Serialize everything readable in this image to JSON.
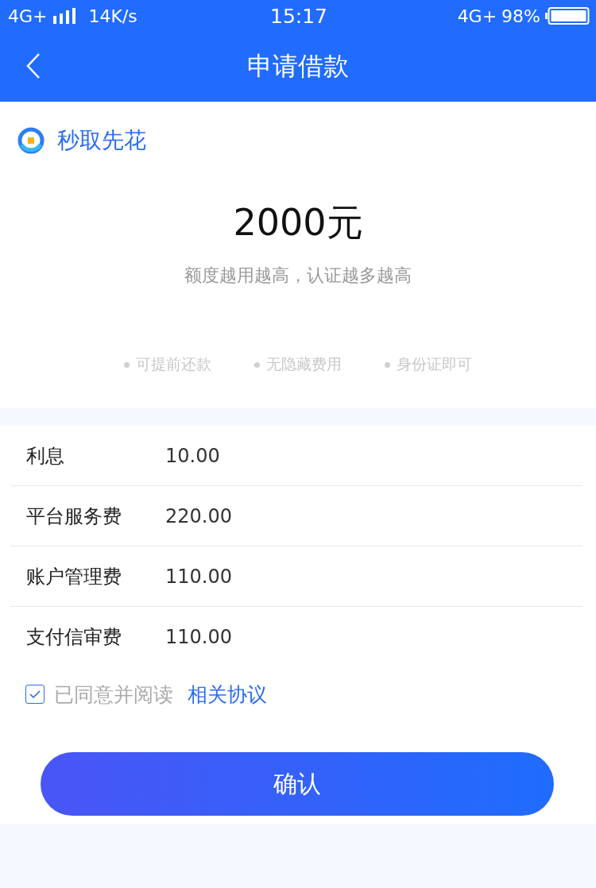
{
  "status_bar": {
    "network": "4G+",
    "speed": "14K/s",
    "time": "15:17",
    "network_right": "4G+",
    "battery": "98%"
  },
  "nav": {
    "title": "申请借款"
  },
  "product": {
    "name": "秒取先花"
  },
  "amount": "2000元",
  "subtitle": "额度越用越高，认证越多越高",
  "features": [
    "可提前还款",
    "无隐藏费用",
    "身份证即可"
  ],
  "fees": [
    {
      "label": "利息",
      "value": "10.00"
    },
    {
      "label": "平台服务费",
      "value": "220.00"
    },
    {
      "label": "账户管理费",
      "value": "110.00"
    },
    {
      "label": "支付信审费",
      "value": "110.00"
    }
  ],
  "agreement": {
    "checked": true,
    "text": "已同意并阅读",
    "link": "相关协议"
  },
  "confirm_button": "确认"
}
